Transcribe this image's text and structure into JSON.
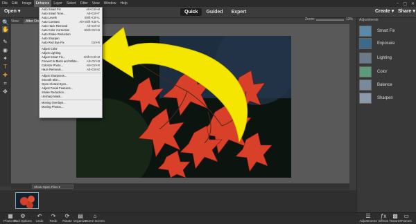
{
  "menubar": {
    "items": [
      "File",
      "Edit",
      "Image",
      "Enhance",
      "Layer",
      "Select",
      "Filter",
      "View",
      "Window",
      "Help"
    ],
    "active": "Enhance"
  },
  "topbar": {
    "open_label": "Open",
    "modes": [
      "Quick",
      "Guided",
      "Expert"
    ],
    "active_mode": "Quick",
    "create_label": "Create",
    "share_label": "Share"
  },
  "viewbar": {
    "view_label": "View:",
    "after_only": "After Only",
    "zoom_label": "Zoom:",
    "zoom_value": "13%"
  },
  "enhance_menu": [
    {
      "label": "Auto Smart Fix",
      "shortcut": "Alt+Ctrl+M"
    },
    {
      "label": "Auto Smart Tone...",
      "shortcut": "Alt+Ctrl+T"
    },
    {
      "label": "Auto Levels",
      "shortcut": "Shift+Ctrl+L"
    },
    {
      "label": "Auto Contrast",
      "shortcut": "Alt+Shift+Ctrl+L"
    },
    {
      "label": "Auto Haze Removal",
      "shortcut": "Alt+Ctrl+Z"
    },
    {
      "label": "Auto Color Correction",
      "shortcut": "Shift+Ctrl+B"
    },
    {
      "label": "Auto Shake Reduction",
      "shortcut": ""
    },
    {
      "label": "Auto Sharpen",
      "shortcut": ""
    },
    {
      "label": "Auto Red Eye Fix",
      "shortcut": "Ctrl+R"
    },
    {
      "label": "Adjust Color",
      "shortcut": ""
    },
    {
      "label": "Adjust Lighting",
      "shortcut": ""
    },
    {
      "label": "Adjust Smart Fix...",
      "shortcut": "Shift+Ctrl+M"
    },
    {
      "label": "Convert to Black and White...",
      "shortcut": "Alt+Ctrl+B"
    },
    {
      "label": "Colorize Photo...",
      "shortcut": "Alt+Ctrl+R"
    },
    {
      "label": "Haze Removal...",
      "shortcut": "Alt+Ctrl+Z"
    },
    {
      "label": "Adjust Sharpness...",
      "shortcut": ""
    },
    {
      "label": "Smooth Skin...",
      "shortcut": ""
    },
    {
      "label": "Open Closed Eyes...",
      "shortcut": ""
    },
    {
      "label": "Adjust Facial Features...",
      "shortcut": ""
    },
    {
      "label": "Shake Reduction...",
      "shortcut": ""
    },
    {
      "label": "Unsharp Mask...",
      "shortcut": ""
    },
    {
      "label": "Moving Overlays...",
      "shortcut": ""
    },
    {
      "label": "Moving Photos...",
      "shortcut": ""
    }
  ],
  "photo_bin": {
    "dropdown_label": "Show Open Files"
  },
  "adjustments": {
    "title": "Adjustments",
    "items": [
      "Smart Fix",
      "Exposure",
      "Lighting",
      "Color",
      "Balance",
      "Sharpen"
    ]
  },
  "bottombar": {
    "left": [
      "Photo Bin",
      "Tool Options",
      "Undo",
      "Redo",
      "Rotate",
      "Organizer",
      "Home Screen"
    ],
    "right": [
      "Adjustments",
      "Effects",
      "Textures",
      "Frames"
    ]
  },
  "colors": {
    "arrow": "#f5e600",
    "leaf_red": "#d8402a",
    "menu_bg": "#ececec"
  }
}
